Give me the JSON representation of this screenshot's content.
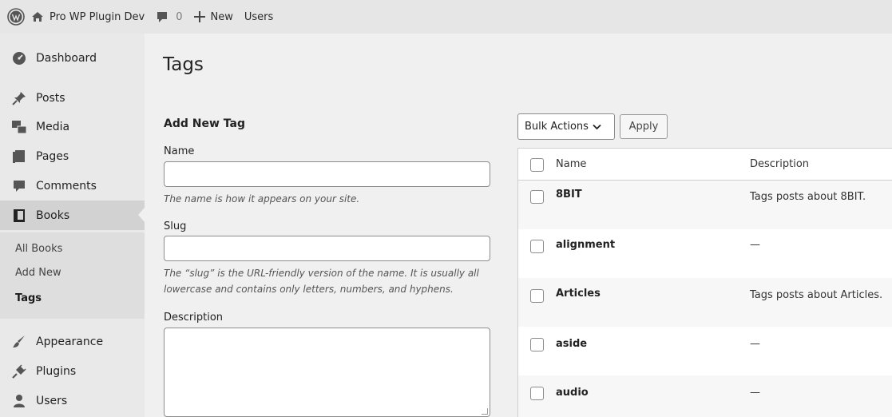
{
  "adminbar": {
    "site_name": "Pro WP Plugin Dev",
    "comments_count": "0",
    "new_label": "New",
    "users_label": "Users"
  },
  "sidebar": {
    "items": [
      {
        "label": "Dashboard",
        "icon": "dashboard-icon"
      },
      {
        "label": "Posts",
        "icon": "pin-icon"
      },
      {
        "label": "Media",
        "icon": "media-icon"
      },
      {
        "label": "Pages",
        "icon": "pages-icon"
      },
      {
        "label": "Comments",
        "icon": "comment-icon"
      },
      {
        "label": "Books",
        "icon": "book-icon"
      },
      {
        "label": "Appearance",
        "icon": "brush-icon"
      },
      {
        "label": "Plugins",
        "icon": "plug-icon"
      },
      {
        "label": "Users",
        "icon": "user-icon"
      }
    ],
    "submenu": [
      "All Books",
      "Add New",
      "Tags"
    ]
  },
  "page": {
    "title": "Tags"
  },
  "form": {
    "heading": "Add New Tag",
    "name_label": "Name",
    "name_value": "",
    "name_help": "The name is how it appears on your site.",
    "slug_label": "Slug",
    "slug_value": "",
    "slug_help_line1": "The “slug” is the URL-friendly version of the name. It is usually all",
    "slug_help_line2": "lowercase and contains only letters, numbers, and hyphens.",
    "description_label": "Description",
    "description_value": ""
  },
  "bulk": {
    "selected": "Bulk Actions",
    "apply_label": "Apply"
  },
  "table": {
    "headers": {
      "name": "Name",
      "description": "Description"
    },
    "rows": [
      {
        "name": "8BIT",
        "description": "Tags posts about 8BIT."
      },
      {
        "name": "alignment",
        "description": "—"
      },
      {
        "name": "Articles",
        "description": "Tags posts about Articles."
      },
      {
        "name": "aside",
        "description": "—"
      },
      {
        "name": "audio",
        "description": "—"
      }
    ]
  }
}
